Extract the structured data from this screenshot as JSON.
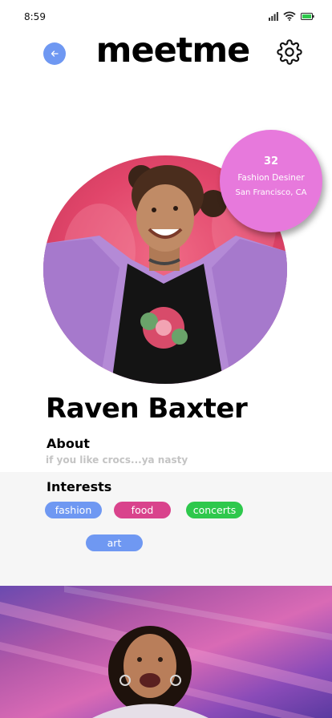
{
  "status_bar": {
    "time": "8:59",
    "icons": [
      "signal-icon",
      "wifi-icon",
      "battery-icon"
    ]
  },
  "header": {
    "back_icon": "arrow-left-icon",
    "title": "meetme",
    "settings_icon": "gear-icon"
  },
  "profile": {
    "age": "32",
    "job": "Fashion Desiner",
    "location": "San Francisco, CA",
    "name": "Raven Baxter"
  },
  "about": {
    "heading": "About",
    "text": "if you like crocs...ya nasty"
  },
  "interests": {
    "heading": "Interests",
    "chips": [
      {
        "label": "fashion",
        "color": "#6f98f2"
      },
      {
        "label": "food",
        "color": "#d9438c"
      },
      {
        "label": "concerts",
        "color": "#2ec84c"
      },
      {
        "label": "art",
        "color": "#6f98f2"
      }
    ]
  },
  "colors": {
    "accent_blue": "#6f98f2",
    "bubble_pink": "#e779dc",
    "panel_gray": "#f6f6f6"
  }
}
